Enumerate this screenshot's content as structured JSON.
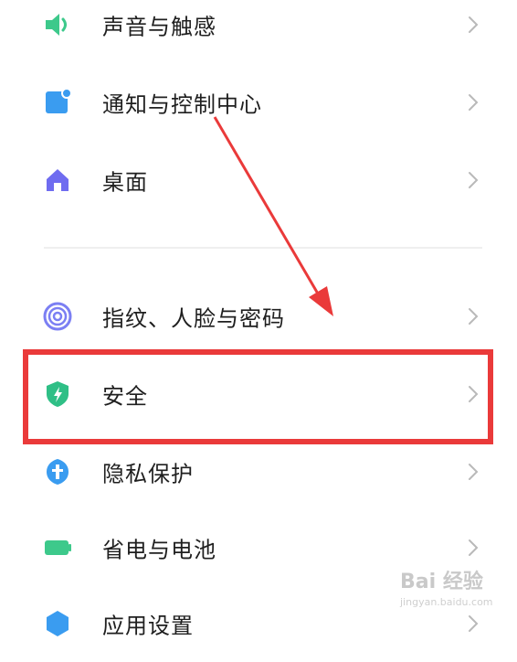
{
  "settings": {
    "items": [
      {
        "label": "声音与触感",
        "icon": "speaker-icon",
        "color": "#3dc98b"
      },
      {
        "label": "通知与控制中心",
        "icon": "notification-icon",
        "color": "#3a9cf0"
      },
      {
        "label": "桌面",
        "icon": "home-icon",
        "color": "#6f6cf0"
      },
      {
        "label": "指纹、人脸与密码",
        "icon": "fingerprint-icon",
        "color": "#7b7ff3"
      },
      {
        "label": "安全",
        "icon": "shield-icon",
        "color": "#2fbf86"
      },
      {
        "label": "隐私保护",
        "icon": "privacy-icon",
        "color": "#3a9cf0"
      },
      {
        "label": "省电与电池",
        "icon": "battery-icon",
        "color": "#3dc98b"
      },
      {
        "label": "应用设置",
        "icon": "app-settings-icon",
        "color": "#3a9cf0"
      }
    ]
  },
  "annotation": {
    "highlight_color": "#ea3a3a",
    "highlighted_item": "安全"
  },
  "watermark": {
    "logo": "Bai 经验",
    "url": "jingyan.baidu.com"
  }
}
